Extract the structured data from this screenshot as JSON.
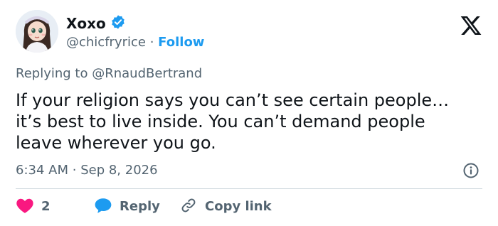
{
  "user": {
    "display_name": "Xoxo",
    "handle": "@chicfryrice",
    "separator": "·",
    "follow_label": "Follow",
    "verified": true
  },
  "reply_context": {
    "prefix": "Replying to",
    "mention": "@RnaudBertrand"
  },
  "tweet": {
    "text": "If your religion says you can’t see certain people…\nit’s best to live inside. You can’t demand people\nleave wherever you go."
  },
  "meta": {
    "time": "6:34 AM",
    "separator": "·",
    "date": "Sep 8, 2026"
  },
  "actions": {
    "like_count": "2",
    "reply_label": "Reply",
    "copy_link_label": "Copy link"
  },
  "colors": {
    "accent": "#1d9bf0",
    "like": "#f91880",
    "secondary_text": "#536471",
    "divider": "#cfd9de"
  },
  "icons": {
    "logo": "x-logo-icon",
    "verified": "verified-badge-icon",
    "info": "info-icon",
    "like": "heart-icon",
    "reply": "speech-bubble-icon",
    "copy_link": "link-icon"
  }
}
